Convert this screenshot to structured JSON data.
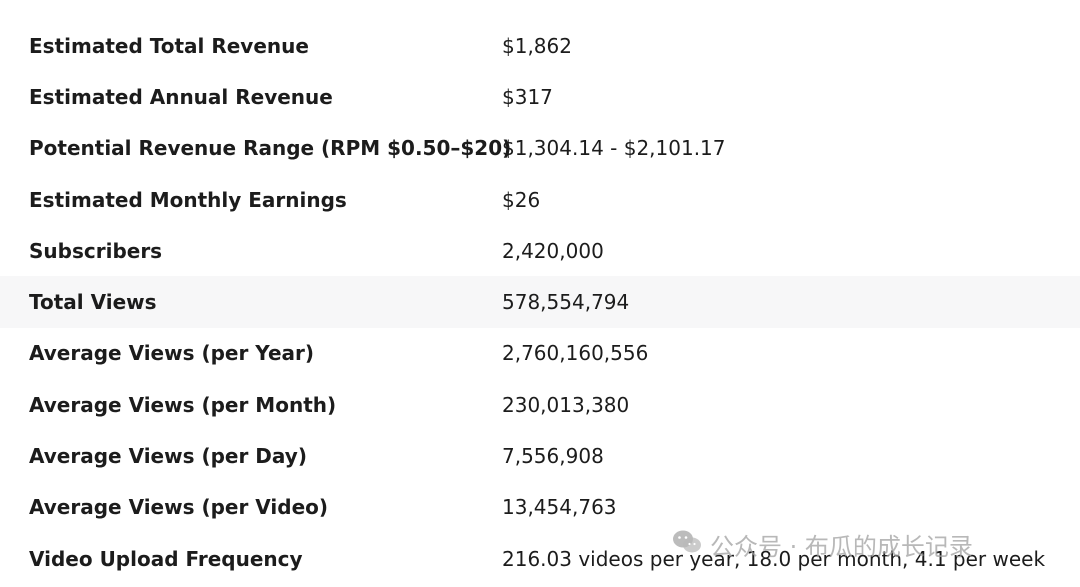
{
  "rows": [
    {
      "label": "Estimated Total Revenue",
      "value": "$1,862"
    },
    {
      "label": "Estimated Annual Revenue",
      "value": "$317"
    },
    {
      "label": "Potential Revenue Range (RPM $0.50–$20)",
      "value": "$1,304.14 - $2,101.17"
    },
    {
      "label": "Estimated Monthly Earnings",
      "value": "$26"
    },
    {
      "label": "Subscribers",
      "value": "2,420,000"
    },
    {
      "label": "Total Views",
      "value": "578,554,794"
    },
    {
      "label": "Average Views (per Year)",
      "value": "2,760,160,556"
    },
    {
      "label": "Average Views (per Month)",
      "value": "230,013,380"
    },
    {
      "label": "Average Views (per Day)",
      "value": "7,556,908"
    },
    {
      "label": "Average Views (per Video)",
      "value": "13,454,763"
    },
    {
      "label": "Video Upload Frequency",
      "value": "216.03 videos per year, 18.0 per month, 4.1 per week"
    }
  ],
  "watermark": {
    "text": "公众号 · 布瓜的成长记录",
    "icon": "wechat-icon"
  },
  "colors": {
    "highlight_row": "#f7f7f8",
    "text": "#1c1c1c"
  }
}
